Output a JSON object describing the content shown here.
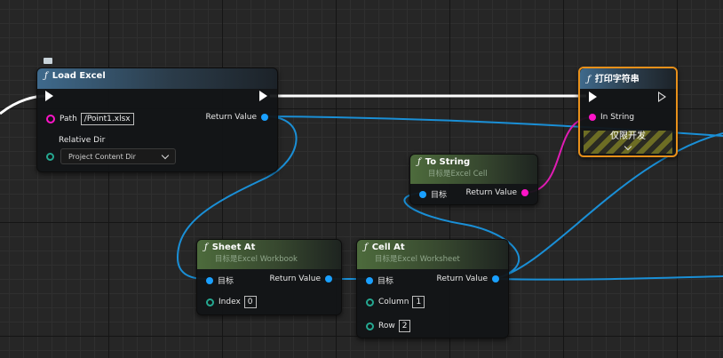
{
  "nodes": {
    "load_excel": {
      "title": "Load Excel",
      "fn_icon": "ƒ",
      "path_label": "Path",
      "path_value": "/Point1.xlsx",
      "relative_dir_label": "Relative Dir",
      "relative_dir_value": "Project Content Dir",
      "return_label": "Return Value"
    },
    "print_string": {
      "title": "打印字符串",
      "fn_icon": "ƒ",
      "in_string_label": "In String",
      "dev_only_label": "仅限开发"
    },
    "to_string": {
      "title": "To String",
      "fn_icon": "ƒ",
      "subtitle": "目标是Excel Cell",
      "target_label": "目标",
      "return_label": "Return Value"
    },
    "sheet_at": {
      "title": "Sheet At",
      "fn_icon": "ƒ",
      "subtitle": "目标是Excel Workbook",
      "target_label": "目标",
      "index_label": "Index",
      "index_value": "0",
      "return_label": "Return Value"
    },
    "cell_at": {
      "title": "Cell At",
      "fn_icon": "ƒ",
      "subtitle": "目标是Excel Worksheet",
      "target_label": "目标",
      "column_label": "Column",
      "column_value": "1",
      "row_label": "Row",
      "row_value": "2",
      "return_label": "Return Value"
    }
  },
  "colors": {
    "exec_wire": "#ffffff",
    "object_wire": "#1a8fd6",
    "string_wire": "#e01cb4",
    "print_highlight": "#e8901a"
  }
}
